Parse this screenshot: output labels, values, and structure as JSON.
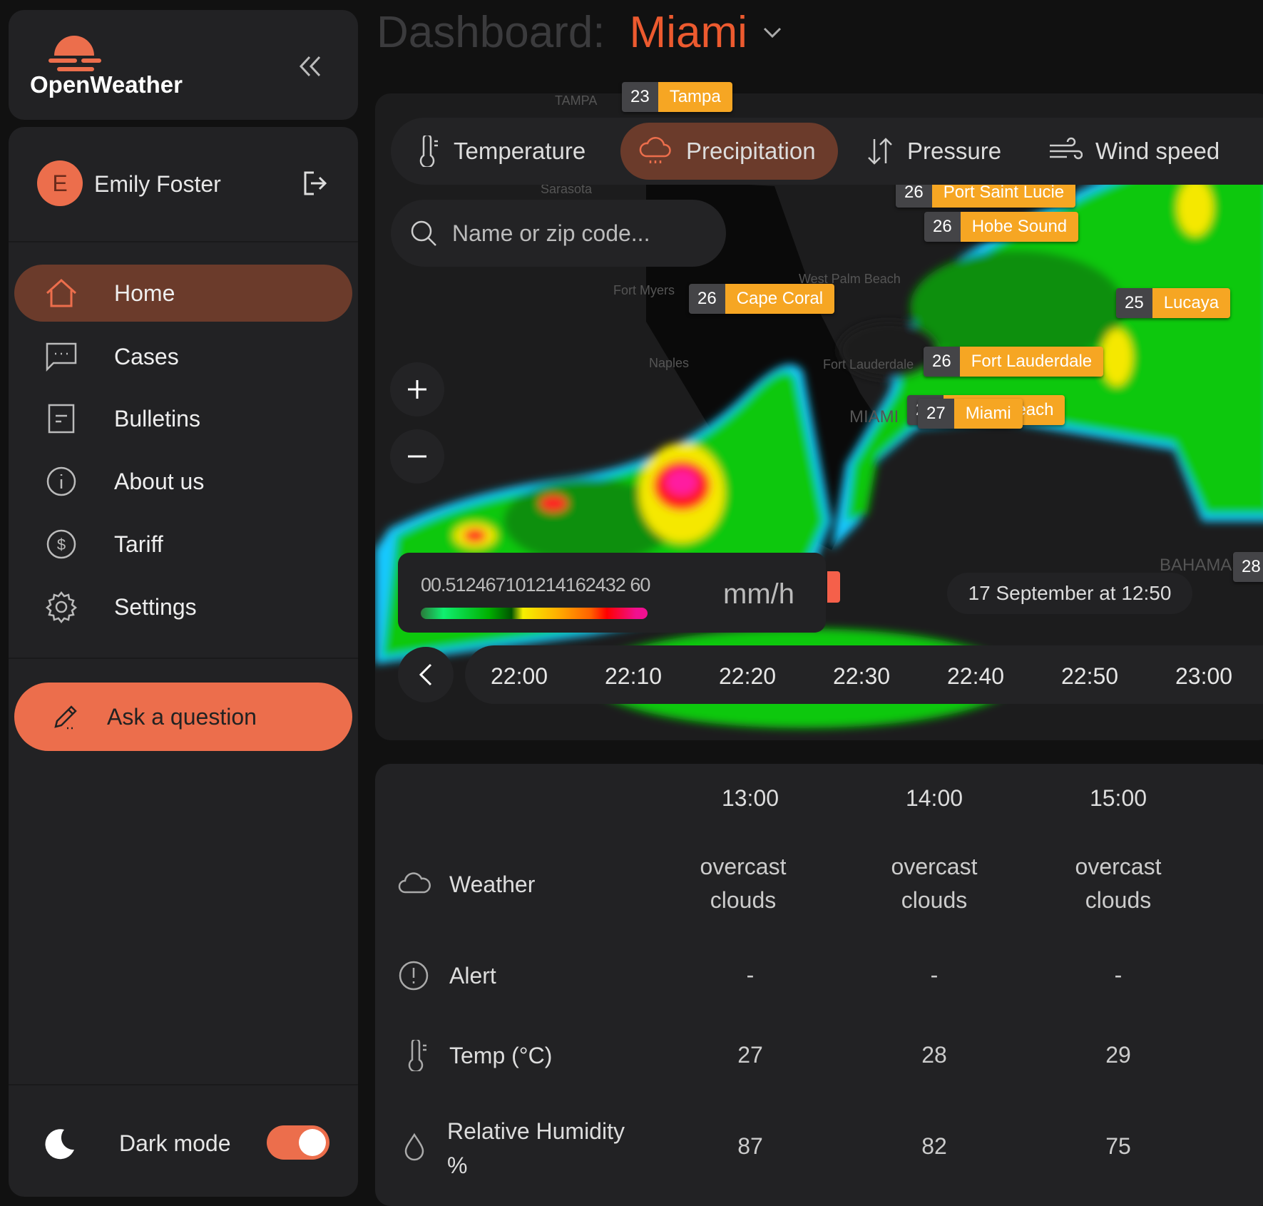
{
  "brand": {
    "name": "OpenWeather",
    "accent": "#ec6e4c"
  },
  "user": {
    "initial": "E",
    "name": "Emily Foster"
  },
  "nav": [
    {
      "label": "Home",
      "icon": "home-icon",
      "active": true
    },
    {
      "label": "Cases",
      "icon": "chat-icon"
    },
    {
      "label": "Bulletins",
      "icon": "document-icon"
    },
    {
      "label": "About us",
      "icon": "info-icon"
    },
    {
      "label": "Tariff",
      "icon": "dollar-icon"
    },
    {
      "label": "Settings",
      "icon": "gear-icon"
    }
  ],
  "ask_button": "Ask a question",
  "dark_mode": {
    "label": "Dark mode",
    "on": true
  },
  "header": {
    "prefix": "Dashboard:",
    "city": "Miami"
  },
  "map": {
    "tabs": [
      {
        "label": "Temperature",
        "active": false
      },
      {
        "label": "Precipitation",
        "active": true
      },
      {
        "label": "Pressure",
        "active": false
      },
      {
        "label": "Wind speed",
        "active": false
      }
    ],
    "search_placeholder": "Name or zip code...",
    "legend": {
      "values": "00.512467101214162432 60",
      "unit": "mm/h"
    },
    "date": "17 September at 12:50",
    "timeline": [
      "22:00",
      "22:10",
      "22:20",
      "22:30",
      "22:40",
      "22:50",
      "23:00"
    ],
    "cities": [
      {
        "t": "23",
        "n": "Tampa"
      },
      {
        "t": "26",
        "n": "Port Saint Lucie"
      },
      {
        "t": "26",
        "n": "Hobe Sound"
      },
      {
        "t": "26",
        "n": "Cape Coral"
      },
      {
        "t": "25",
        "n": "Lucaya"
      },
      {
        "t": "26",
        "n": "Fort Lauderdale"
      },
      {
        "t": "27",
        "n": "Miami Beach"
      },
      {
        "t": "27",
        "n": "Miami"
      },
      {
        "t": "28",
        "n": ""
      }
    ],
    "place_labels": [
      "TAMPA",
      "Sarasota",
      "Fort Myers",
      "Naples",
      "West Palm Beach",
      "Fort Lauderdale",
      "MIAMI",
      "BAHAMAS"
    ]
  },
  "forecast": {
    "times": [
      "13:00",
      "14:00",
      "15:00"
    ],
    "rows": [
      {
        "label": "Weather",
        "icon": "cloud-icon",
        "values": [
          "overcast clouds",
          "overcast clouds",
          "overcast clouds"
        ]
      },
      {
        "label": "Alert",
        "icon": "alert-icon",
        "values": [
          "-",
          "-",
          "-"
        ]
      },
      {
        "label": "Temp (°C)",
        "icon": "thermometer-icon",
        "values": [
          "27",
          "28",
          "29"
        ]
      },
      {
        "label": "Relative Humidity %",
        "icon": "droplet-icon",
        "values": [
          "87",
          "82",
          "75"
        ]
      }
    ]
  }
}
